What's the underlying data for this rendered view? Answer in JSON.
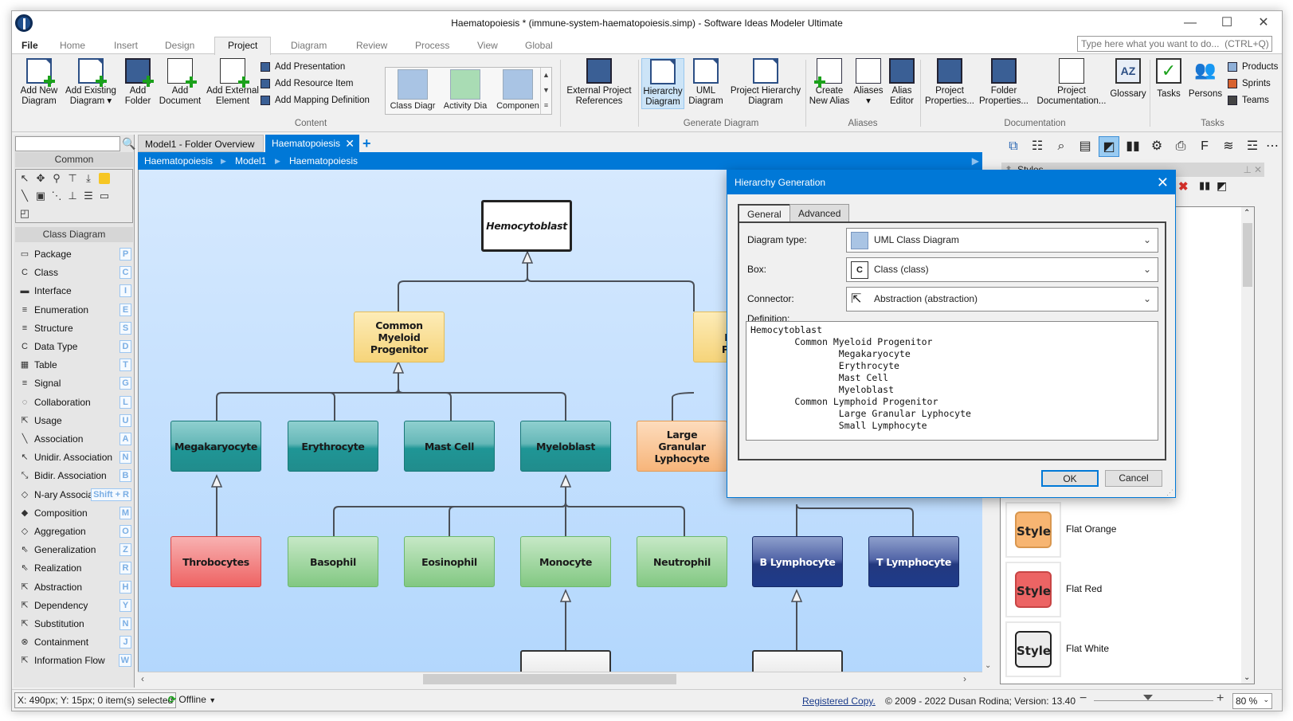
{
  "window": {
    "title": "Haematopoiesis * (immune-system-haematopoiesis.simp) - Software Ideas Modeler Ultimate",
    "controls": {
      "minimize": "—",
      "maximize": "☐",
      "close": "✕"
    }
  },
  "menu": {
    "tabs": [
      "File",
      "Home",
      "Insert",
      "Design",
      "Project",
      "Diagram",
      "Review",
      "Process",
      "View",
      "Global"
    ],
    "active": "Project",
    "quick_search_placeholder": "Type here what you want to do...  (CTRL+Q)"
  },
  "ribbon": {
    "content": {
      "label": "Content",
      "buttons": [
        {
          "label1": "Add New",
          "label2": "Diagram"
        },
        {
          "label1": "Add Existing",
          "label2": "Diagram ▾"
        },
        {
          "label1": "Add",
          "label2": "Folder"
        },
        {
          "label1": "Add",
          "label2": "Document"
        },
        {
          "label1": "Add External",
          "label2": "Element"
        }
      ],
      "small": [
        "Add Presentation",
        "Add Resource Item",
        "Add Mapping Definition"
      ],
      "gallery": [
        "Class Diagr",
        "Activity Dia",
        "Componen"
      ]
    },
    "external": {
      "label1": "External Project",
      "label2": "References"
    },
    "generate": {
      "label": "Generate Diagram",
      "buttons": [
        {
          "label1": "Hierarchy",
          "label2": "Diagram",
          "selected": true
        },
        {
          "label1": "UML",
          "label2": "Diagram"
        },
        {
          "label1": "Project Hierarchy",
          "label2": "Diagram"
        }
      ]
    },
    "aliases": {
      "label": "Aliases",
      "buttons": [
        {
          "label1": "Create",
          "label2": "New Alias"
        },
        {
          "label1": "Aliases",
          "label2": "▾"
        },
        {
          "label1": "Alias",
          "label2": "Editor"
        }
      ]
    },
    "documentation": {
      "label": "Documentation",
      "buttons": [
        {
          "label1": "Project",
          "label2": "Properties..."
        },
        {
          "label1": "Folder",
          "label2": "Properties..."
        },
        {
          "label1": "Project",
          "label2": "Documentation..."
        },
        {
          "label1": "Glossary",
          "label2": ""
        }
      ]
    },
    "tasks": {
      "label": "Tasks",
      "buttons": [
        {
          "label1": "Tasks"
        },
        {
          "label1": "Persons"
        }
      ],
      "small": [
        "Products",
        "Sprints",
        "Teams"
      ]
    }
  },
  "left_panel": {
    "search_value": "",
    "common_header": "Common",
    "class_header": "Class Diagram",
    "items": [
      {
        "label": "Package",
        "key": "P",
        "icon": "package-icon"
      },
      {
        "label": "Class",
        "key": "C",
        "icon": "class-icon"
      },
      {
        "label": "Interface",
        "key": "I",
        "icon": "interface-icon"
      },
      {
        "label": "Enumeration",
        "key": "E",
        "icon": "enumeration-icon"
      },
      {
        "label": "Structure",
        "key": "S",
        "icon": "structure-icon"
      },
      {
        "label": "Data Type",
        "key": "D",
        "icon": "data-type-icon"
      },
      {
        "label": "Table",
        "key": "T",
        "icon": "table-icon"
      },
      {
        "label": "Signal",
        "key": "G",
        "icon": "signal-icon"
      },
      {
        "label": "Collaboration",
        "key": "L",
        "icon": "collaboration-icon"
      },
      {
        "label": "Usage",
        "key": "U",
        "icon": "usage-icon"
      },
      {
        "label": "Association",
        "key": "A",
        "icon": "association-icon"
      },
      {
        "label": "Unidir. Association",
        "key": "N",
        "icon": "unidirectional-association-icon"
      },
      {
        "label": "Bidir. Association",
        "key": "B",
        "icon": "bidirectional-association-icon"
      },
      {
        "label": "N-ary Associat",
        "key": "Shift + R",
        "icon": "nary-association-icon"
      },
      {
        "label": "Composition",
        "key": "M",
        "icon": "composition-icon"
      },
      {
        "label": "Aggregation",
        "key": "O",
        "icon": "aggregation-icon"
      },
      {
        "label": "Generalization",
        "key": "Z",
        "icon": "generalization-icon"
      },
      {
        "label": "Realization",
        "key": "R",
        "icon": "realization-icon"
      },
      {
        "label": "Abstraction",
        "key": "H",
        "icon": "abstraction-icon"
      },
      {
        "label": "Dependency",
        "key": "Y",
        "icon": "dependency-icon"
      },
      {
        "label": "Substitution",
        "key": "N",
        "icon": "substitution-icon"
      },
      {
        "label": "Containment",
        "key": "J",
        "icon": "containment-icon"
      },
      {
        "label": "Information Flow",
        "key": "W",
        "icon": "information-flow-icon"
      }
    ]
  },
  "doc_tabs": [
    {
      "label": "Model1 - Folder Overview",
      "active": false
    },
    {
      "label": "Haematopoiesis",
      "active": true
    }
  ],
  "breadcrumb": [
    "Haematopoiesis",
    "Model1",
    "Haematopoiesis"
  ],
  "diagram": {
    "nodes": {
      "root": "Hemocytoblast",
      "cmp": "Common Myeloid Progenitor",
      "clp": "Common Lymphoid Progenitor",
      "mega": "Megakaryocyte",
      "ery": "Erythrocyte",
      "mast": "Mast Cell",
      "myelo": "Myeloblast",
      "lgl": "Large Granular Lyphocyte",
      "thr": "Throbocytes",
      "baso": "Basophil",
      "eos": "Eosinophil",
      "mono": "Monocyte",
      "neut": "Neutrophil",
      "blym": "B Lymphocyte",
      "tlym": "T Lymphocyte"
    },
    "colors": {
      "teal": "#1f9696",
      "yellow": "#f6d47a",
      "orange": "#f7b57a",
      "red": "#ee6363",
      "green": "#82c882",
      "blue": "#1e3a8a",
      "canvas": "#c4e0fe"
    }
  },
  "styles_panel": {
    "title": "Styles",
    "items": [
      {
        "swatch": "Style",
        "name": "Flat Orange",
        "color": "#f7b572"
      },
      {
        "swatch": "Style",
        "name": "Flat Red",
        "color": "#ec6464"
      },
      {
        "swatch": "Style",
        "name": "Flat White",
        "color": "#ececec"
      }
    ]
  },
  "dialog": {
    "title": "Hierarchy Generation",
    "tabs": [
      "General",
      "Advanced"
    ],
    "active_tab": "General",
    "diagram_type_label": "Diagram type:",
    "diagram_type_value": "UML Class Diagram",
    "box_label": "Box:",
    "box_value": "Class (class)",
    "connector_label": "Connector:",
    "connector_value": "Abstraction (abstraction)",
    "definition_label": "Definition:",
    "definition": "Hemocytoblast\n        Common Myeloid Progenitor\n                Megakaryocyte\n                Erythrocyte\n                Mast Cell\n                Myeloblast\n        Common Lymphoid Progenitor\n                Large Granular Lyphocyte\n                Small Lymphocyte",
    "ok": "OK",
    "cancel": "Cancel"
  },
  "status": {
    "position": "X: 490px; Y: 15px; 0 item(s) selected",
    "connection": "Offline",
    "registered": "Registered Copy.",
    "copyright": "© 2009 - 2022 Dusan Rodina; Version: 13.40",
    "zoom": "80 %",
    "zoom_fraction": 0.45
  }
}
